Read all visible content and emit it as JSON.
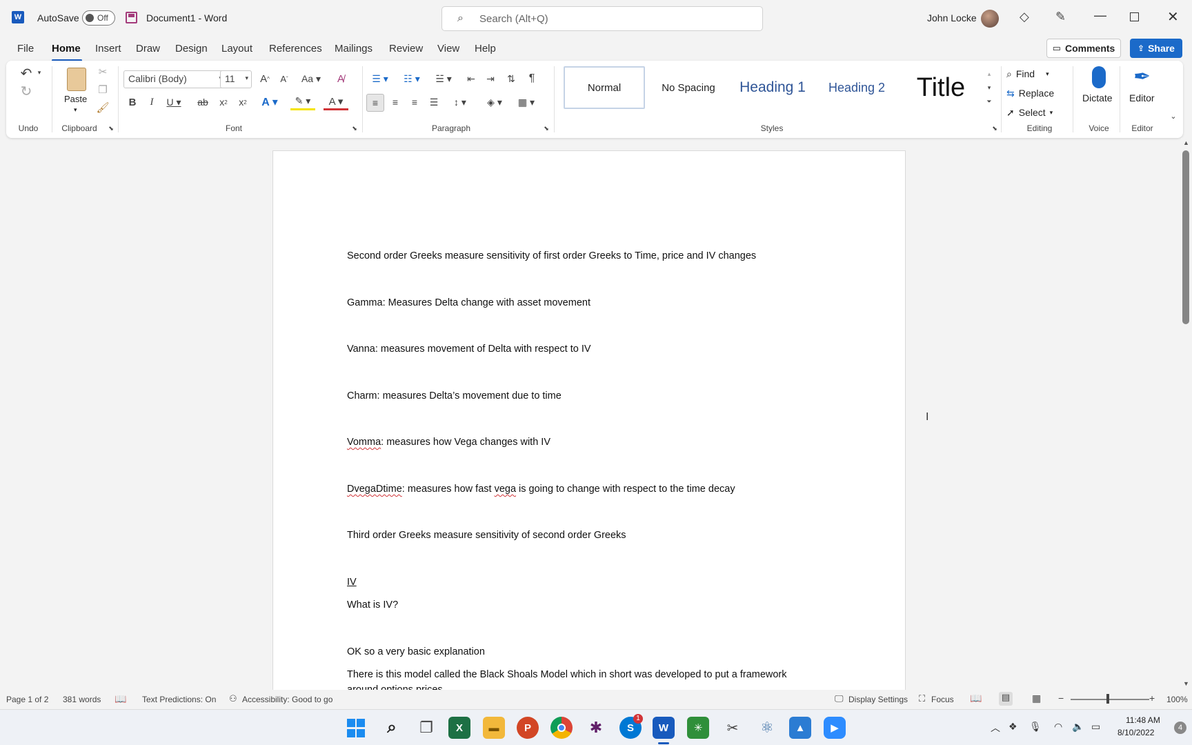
{
  "titlebar": {
    "autosave_label": "AutoSave",
    "autosave_state": "Off",
    "doc_name": "Document1",
    "separator": "-",
    "app_name": "Word",
    "search_placeholder": "Search (Alt+Q)",
    "user_name": "John Locke"
  },
  "menu": {
    "items": [
      "File",
      "Home",
      "Insert",
      "Draw",
      "Design",
      "Layout",
      "References",
      "Mailings",
      "Review",
      "View",
      "Help"
    ],
    "comments_label": "Comments",
    "share_label": "Share"
  },
  "ribbon": {
    "groups": {
      "undo": "Undo",
      "clipboard": "Clipboard",
      "font": "Font",
      "paragraph": "Paragraph",
      "styles": "Styles",
      "editing": "Editing",
      "voice": "Voice",
      "editor": "Editor"
    },
    "paste_label": "Paste",
    "font_name": "Calibri (Body)",
    "font_size": "11",
    "styles": [
      "Normal",
      "No Spacing",
      "Heading 1",
      "Heading 2",
      "Title"
    ],
    "find_label": "Find",
    "replace_label": "Replace",
    "select_label": "Select",
    "dictate_label": "Dictate",
    "editor_label": "Editor"
  },
  "document": {
    "paragraphs": [
      {
        "text": "Second order Greeks measure sensitivity of first order Greeks to Time, price and IV changes"
      },
      {
        "text": "Gamma: Measures Delta change with asset movement"
      },
      {
        "text": "Vanna: measures movement of Delta with respect to IV"
      },
      {
        "text": "Charm: measures Delta’s movement due to time"
      },
      {
        "prefix": "Vomma",
        "text": ": measures how Vega changes with IV"
      },
      {
        "prefix": "DvegaDtime",
        "text": ": measures how fast ",
        "mid": "vega",
        "rest": " is going to change with respect to the time decay"
      },
      {
        "text": "Third order Greeks measure sensitivity of second order Greeks"
      },
      {
        "text": "IV"
      },
      {
        "text": "What is IV?"
      },
      {
        "text": "OK so a very basic explanation"
      },
      {
        "text": "There is this model called the Black Shoals Model which in short was developed to put a framework"
      },
      {
        "text": "around options prices"
      }
    ]
  },
  "status": {
    "page": "Page 1 of 2",
    "words": "381 words",
    "predictions": "Text Predictions: On",
    "accessibility": "Accessibility: Good to go",
    "display_settings": "Display Settings",
    "focus": "Focus",
    "zoom": "100%"
  },
  "taskbar": {
    "time": "11:48 AM",
    "date": "8/10/2022",
    "notification_count": "4",
    "skype_badge": "1"
  },
  "colors": {
    "accent": "#185abd",
    "ribbon_bg": "#ffffff",
    "share_bg": "#1b6ac9"
  }
}
